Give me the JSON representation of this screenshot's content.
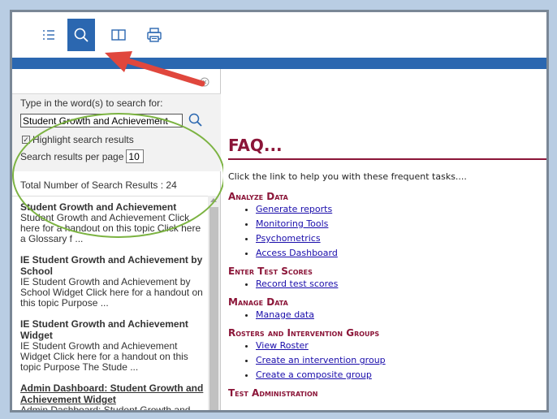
{
  "toolbar": {
    "buttons": [
      {
        "name": "contents",
        "icon": "list-icon"
      },
      {
        "name": "search",
        "icon": "search-icon",
        "active": true
      },
      {
        "name": "glossary",
        "icon": "book-icon"
      },
      {
        "name": "print",
        "icon": "printer-icon"
      }
    ],
    "accent": "#2b67b0"
  },
  "search": {
    "prompt": "Type in the word(s) to search for:",
    "query": "Student Growth and Achievement",
    "highlight_label": "Highlight search results",
    "highlight_checked": true,
    "per_page_label": "Search results per page",
    "per_page_value": "10",
    "total_label": "Total Number of Search Results : 24"
  },
  "results": [
    {
      "title": "Student Growth and Achievement",
      "snippet": "Student Growth and Achievement Click here for a handout on this topic Click here a Glossary f ..."
    },
    {
      "title": "IE Student Growth and Achievement by School",
      "snippet": "IE Student Growth and Achievement by School Widget Click here for a handout on this topic Purpose ..."
    },
    {
      "title": "IE Student Growth and Achievement Widget",
      "snippet": "IE Student Growth and Achievement Widget Click here for a handout on this topic Purpose The Stude ..."
    },
    {
      "title": "Admin Dashboard: Student Growth and Achievement Widget",
      "snippet": "Admin Dashboard: Student Growth and"
    }
  ],
  "faq": {
    "title": "FAQ...",
    "intro": "Click the link to help you with these frequent tasks....",
    "title_color": "#8b1538",
    "sections": [
      {
        "heading": "Analyze Data",
        "links": [
          "Generate reports",
          "Monitoring Tools",
          "Psychometrics",
          "Access Dashboard"
        ]
      },
      {
        "heading": "Enter Test Scores",
        "links": [
          "Record test scores"
        ]
      },
      {
        "heading": "Manage Data",
        "links": [
          "Manage data"
        ]
      },
      {
        "heading": "Rosters and Intervention Groups",
        "links": [
          "View Roster",
          "Create an intervention group",
          "Create a composite group"
        ]
      },
      {
        "heading": "Test Administration",
        "links": []
      }
    ]
  },
  "annotations": {
    "oval_color": "#7cb342",
    "arrow_color": "#e0473d"
  }
}
